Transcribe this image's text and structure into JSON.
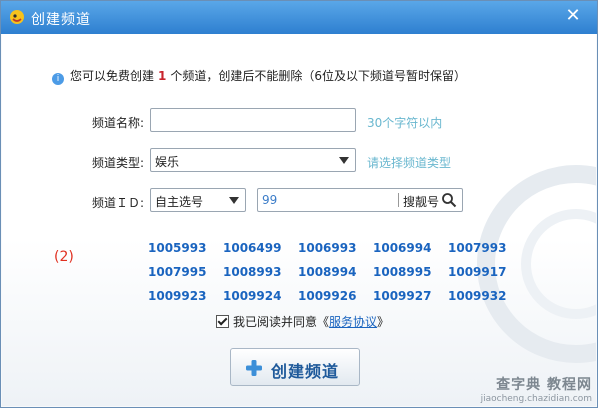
{
  "window": {
    "title": "创建频道",
    "close_glyph": "✕"
  },
  "info": {
    "prefix": "您可以免费创建",
    "count": "1",
    "suffix": "个频道，创建后不能删除（6位及以下频道号暂时保留）"
  },
  "form": {
    "name_label": "频道名称:",
    "name_value": "",
    "name_hint": "30个字符以内",
    "type_label": "频道类型:",
    "type_selected": "娱乐",
    "type_hint": "请选择频道类型",
    "id_label": "频道ＩＤ:",
    "id_mode_selected": "自主选号",
    "search_value": "99",
    "search_button_label": "搜靓号"
  },
  "marker": "(2)",
  "numbers": [
    [
      "1005993",
      "1006499",
      "1006993",
      "1006994",
      "1007993"
    ],
    [
      "1007995",
      "1008993",
      "1008994",
      "1008995",
      "1009917"
    ],
    [
      "1009923",
      "1009924",
      "1009926",
      "1009927",
      "1009932"
    ]
  ],
  "agree": {
    "checked": true,
    "text": "我已阅读并同意《",
    "link": "服务协议",
    "tail": "》"
  },
  "create_button": "创建频道",
  "watermark": {
    "main": "查字典 教程网",
    "sub": "jiaocheng.chazidian.com"
  },
  "colors": {
    "titlebar": "#2e7fd0",
    "link": "#1a64bf",
    "hint": "#69b7cf",
    "count": "#c8232c",
    "marker": "#e03020"
  }
}
